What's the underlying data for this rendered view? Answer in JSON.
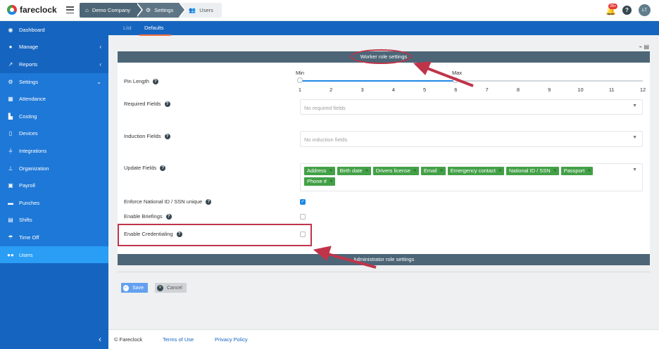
{
  "brand": {
    "name": "fareclock"
  },
  "breadcrumb": [
    {
      "label": "Demo Company",
      "icon": "home-icon"
    },
    {
      "label": "Settings",
      "icon": "gear-icon"
    },
    {
      "label": "Users",
      "icon": "users-icon"
    }
  ],
  "header": {
    "notification_count": "28+",
    "help_label": "?",
    "avatar_initials": "LT"
  },
  "sidebar": {
    "items": [
      {
        "label": "Dashboard",
        "icon": "dashboard-icon"
      },
      {
        "label": "Manage",
        "icon": "user-icon",
        "chevron": "‹"
      },
      {
        "label": "Reports",
        "icon": "chart-icon",
        "chevron": "‹"
      },
      {
        "label": "Settings",
        "icon": "gear-icon",
        "chevron": "⌄"
      },
      {
        "label": "Attendance",
        "icon": "attendance-icon"
      },
      {
        "label": "Costing",
        "icon": "costing-icon"
      },
      {
        "label": "Devices",
        "icon": "tablet-icon"
      },
      {
        "label": "Integrations",
        "icon": "plug-icon"
      },
      {
        "label": "Organization",
        "icon": "org-chart-icon"
      },
      {
        "label": "Payroll",
        "icon": "money-icon"
      },
      {
        "label": "Punches",
        "icon": "briefcase-icon"
      },
      {
        "label": "Shifts",
        "icon": "calendar-icon"
      },
      {
        "label": "Time Off",
        "icon": "umbrella-icon"
      },
      {
        "label": "Users",
        "icon": "users-icon"
      }
    ],
    "collapse_glyph": "‹"
  },
  "tabs": [
    {
      "label": "List"
    },
    {
      "label": "Defaults"
    }
  ],
  "worker_section": {
    "title": "Worker role settings",
    "pin_length": {
      "label": "Pin Length",
      "min_label": "Min",
      "max_label": "Max",
      "range_min": 1,
      "range_max": 12,
      "min_value": 1,
      "max_value": 6,
      "ticks": [
        "1",
        "2",
        "3",
        "4",
        "5",
        "6",
        "7",
        "8",
        "9",
        "10",
        "11",
        "12"
      ]
    },
    "required_fields": {
      "label": "Required Fields",
      "placeholder": "No required fields"
    },
    "induction_fields": {
      "label": "Induction Fields",
      "placeholder": "No induction fields"
    },
    "update_fields": {
      "label": "Update Fields",
      "tags": [
        "Address",
        "Birth date",
        "Drivers license",
        "Email",
        "Emergency contact",
        "National ID / SSN",
        "Passport",
        "Phone #"
      ]
    },
    "enforce_unique": {
      "label": "Enforce National ID / SSN unique",
      "checked": true
    },
    "enable_briefings": {
      "label": "Enable Briefings",
      "checked": false
    },
    "enable_credentialing": {
      "label": "Enable Credentialing",
      "checked": false
    }
  },
  "admin_section": {
    "title": "Administrator role settings"
  },
  "actions": {
    "save_label": "Save",
    "cancel_label": "Cancel"
  },
  "footer": {
    "copyright": "© Fareclock",
    "terms": "Terms of Use",
    "privacy": "Privacy Policy"
  },
  "colors": {
    "sidebar": "#1565c0",
    "section_header": "#4d6677",
    "tag": "#43a047",
    "annotation": "#c0344a"
  }
}
